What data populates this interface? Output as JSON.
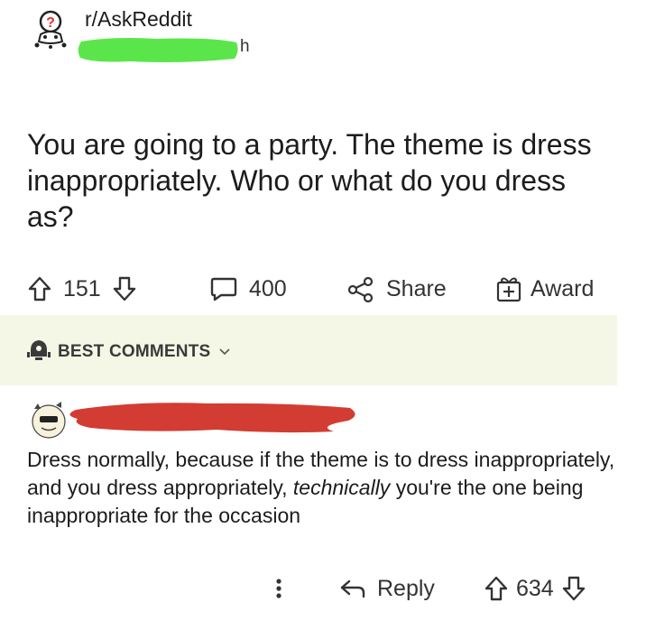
{
  "post": {
    "subreddit": "r/AskReddit",
    "time_suffix": "h",
    "title": "You are going to a party. The theme is dress inappropriately. Who or what do you dress as?"
  },
  "actions": {
    "upvotes": "151",
    "comments": "400",
    "share_label": "Share",
    "award_label": "Award"
  },
  "best_comments": {
    "label": "BEST COMMENTS"
  },
  "comment": {
    "text_part1": "Dress normally, because if the theme is to dress inappropriately, and you dress appropriately, ",
    "text_emphasis": "technically",
    "text_part2": " you're the one being inappropriate for the occasion",
    "reply_label": "Reply",
    "votes": "634"
  },
  "colors": {
    "redaction_green": "#5ae64b",
    "redaction_red": "#d23c32",
    "best_bar_bg": "#f4f7e6"
  },
  "icons": {
    "subreddit_avatar": "askreddit-snoo-icon",
    "upvote": "upvote-arrow-icon",
    "downvote": "downvote-arrow-icon",
    "comment": "comment-bubble-icon",
    "share": "share-icon",
    "award": "gift-icon",
    "best": "rocket-icon",
    "more": "vertical-dots-icon",
    "reply": "reply-arrow-icon"
  }
}
